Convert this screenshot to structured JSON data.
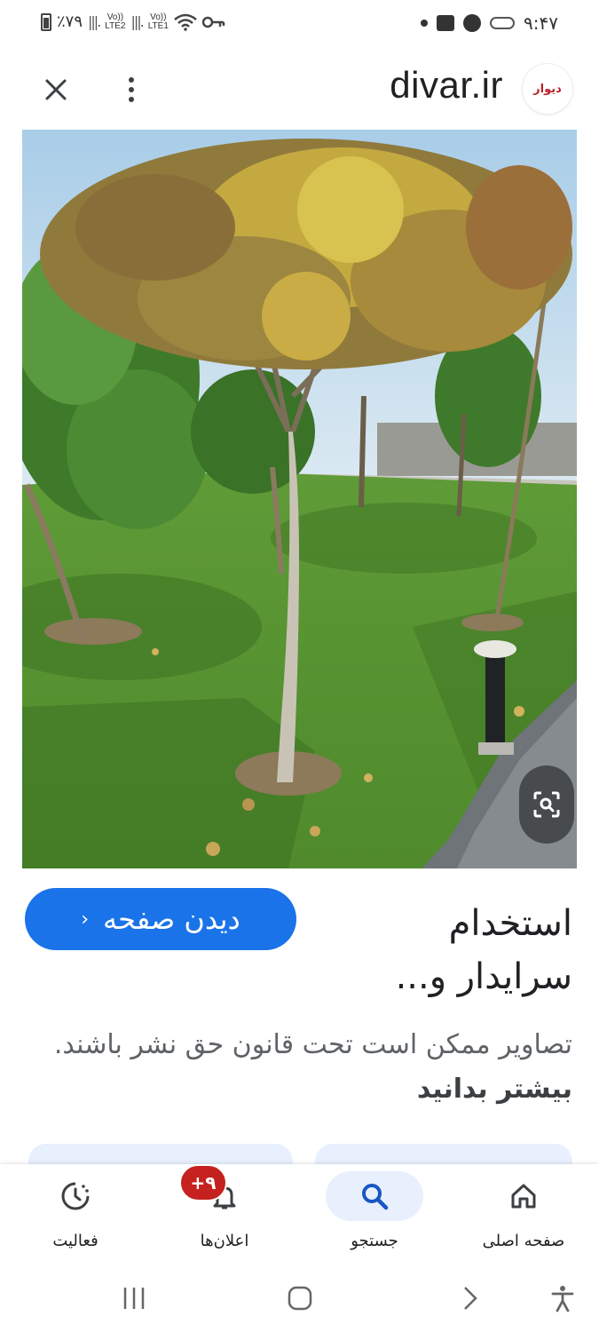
{
  "status_bar": {
    "battery_percent": "٪۷۹",
    "sim1_label": "LTE2",
    "sim2_label": "LTE1",
    "volte1": "Vo))",
    "volte2": "Vo))",
    "time": "۹:۴۷"
  },
  "header": {
    "site_title": "divar.ir",
    "logo_text": "دیوار"
  },
  "image": {
    "description_icon": "tree-photo"
  },
  "result": {
    "visit_button_label": "دیدن صفحه",
    "visit_button_chevron": "›",
    "title_line1": "استخدام",
    "title_line2": "سرایدار و...",
    "copyright_text": "تصاویر ممکن است تحت قانون حق نشر باشند.",
    "learn_more": "بیشتر بدانید"
  },
  "bottom_nav": {
    "items": [
      {
        "label": "صفحه اصلی",
        "icon": "home-icon"
      },
      {
        "label": "جستجو",
        "icon": "search-icon"
      },
      {
        "label": "اعلان‌ها",
        "icon": "bell-icon",
        "badge": "+۹"
      },
      {
        "label": "فعالیت",
        "icon": "activity-icon"
      }
    ],
    "active": "جستجو"
  },
  "colors": {
    "accent": "#1a73e8",
    "badge": "#c5221f",
    "brand": "#b8232a"
  }
}
